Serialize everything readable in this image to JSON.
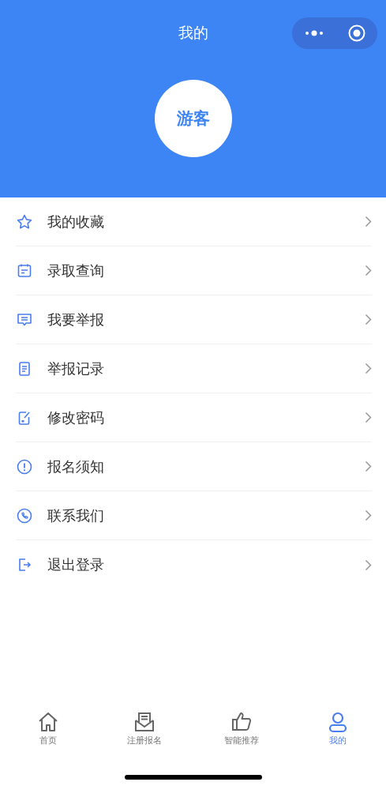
{
  "header": {
    "title": "我的",
    "avatar": "游客"
  },
  "menu": [
    {
      "label": "我的收藏"
    },
    {
      "label": "录取查询"
    },
    {
      "label": "我要举报"
    },
    {
      "label": "举报记录"
    },
    {
      "label": "修改密码"
    },
    {
      "label": "报名须知"
    },
    {
      "label": "联系我们"
    },
    {
      "label": "退出登录"
    }
  ],
  "tabs": [
    {
      "label": "首页",
      "selected": false
    },
    {
      "label": "注册报名",
      "selected": false
    },
    {
      "label": "智能推荐",
      "selected": false
    },
    {
      "label": "我的",
      "selected": true
    }
  ]
}
